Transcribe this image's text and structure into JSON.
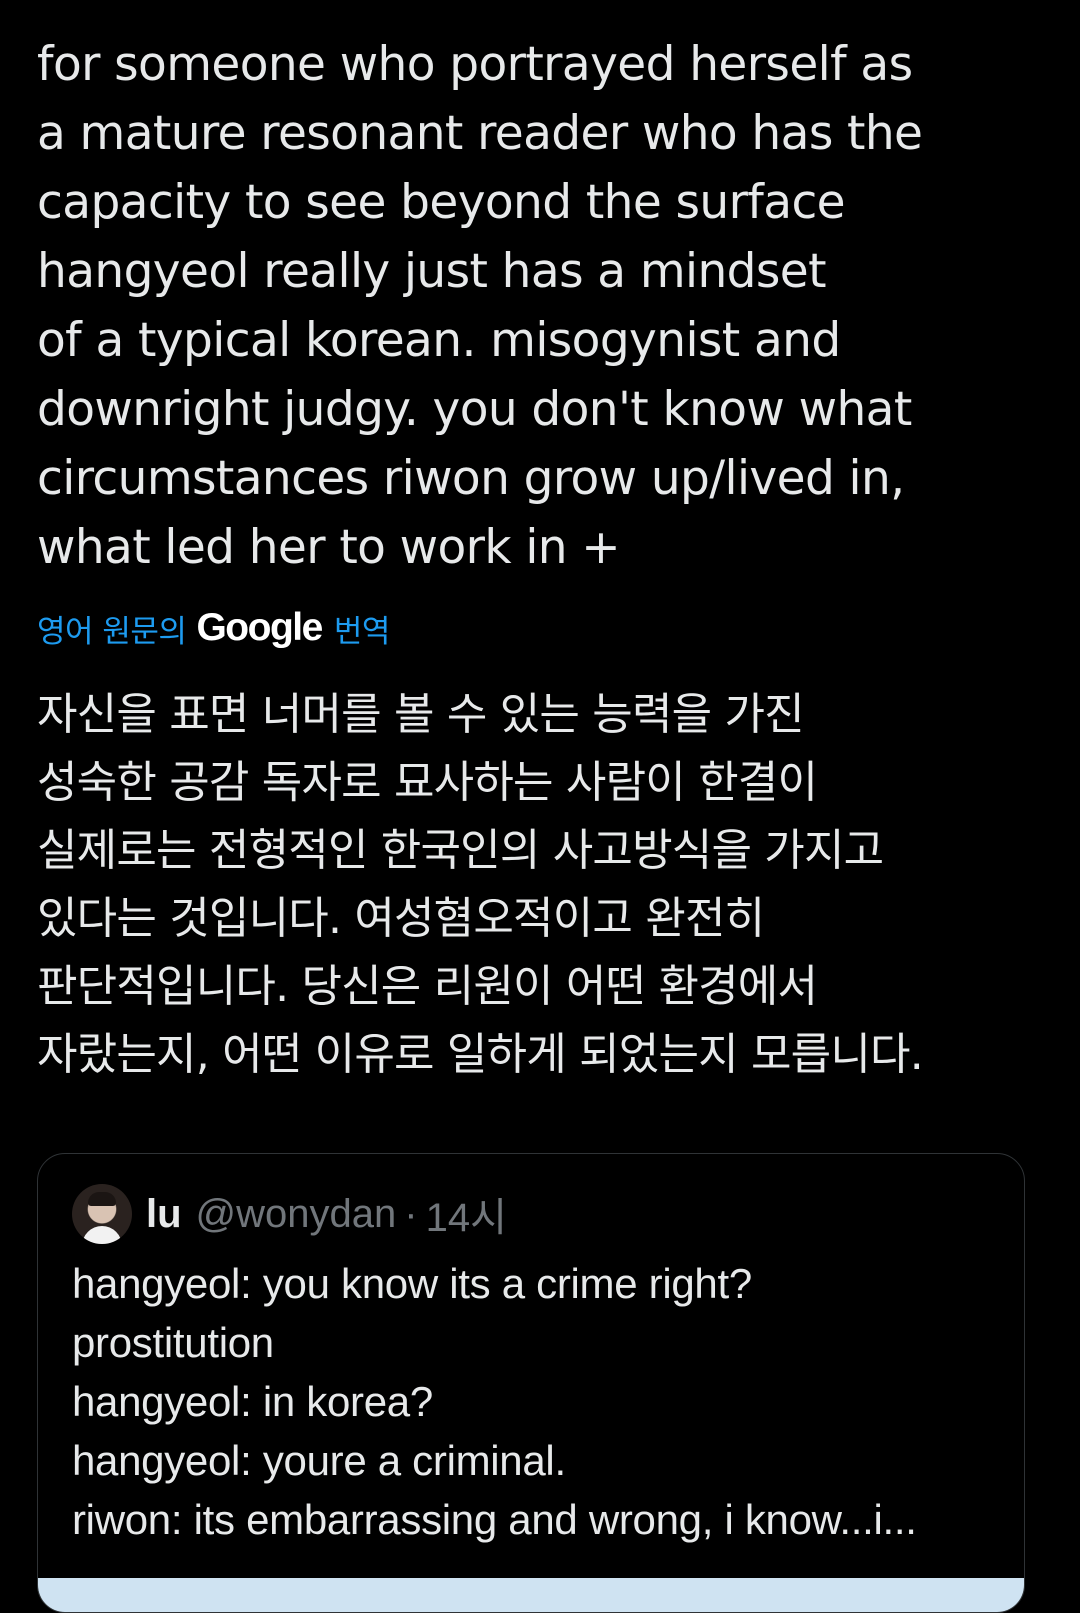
{
  "tweet": {
    "lines": [
      "for someone who portrayed herself as",
      "a mature resonant reader who has the",
      "capacity to see beyond the surface",
      "hangyeol really just has a mindset",
      "of a typical korean. misogynist and",
      "downright judgy. you don't know what",
      "circumstances riwon grow up/lived in,",
      "what led her to work in +"
    ]
  },
  "translation": {
    "prefix": "영어 원문의",
    "provider": "Google",
    "suffix": "번역",
    "lines": [
      "자신을 표면 너머를 볼 수 있는 능력을 가진",
      "성숙한 공감 독자로 묘사하는 사람이 한결이",
      "실제로는 전형적인 한국인의 사고방식을 가지고",
      "있다는 것입니다. 여성혐오적이고 완전히",
      "판단적입니다. 당신은 리원이 어떤 환경에서",
      "자랐는지, 어떤 이유로 일하게 되었는지 모릅니다."
    ]
  },
  "quote": {
    "display_name": "lu",
    "handle": "@wonydan",
    "separator": "·",
    "time": "14시",
    "lines": [
      "hangyeol: you know its a crime right?",
      "prostitution",
      "hangyeol: in korea?",
      "hangyeol: youre a criminal.",
      "riwon: its embarrassing and wrong, i know...i..."
    ]
  },
  "colors": {
    "background": "#000000",
    "text": "#e7e9ea",
    "link": "#1d9bf0",
    "muted": "#71767b",
    "border": "#2f3336"
  }
}
